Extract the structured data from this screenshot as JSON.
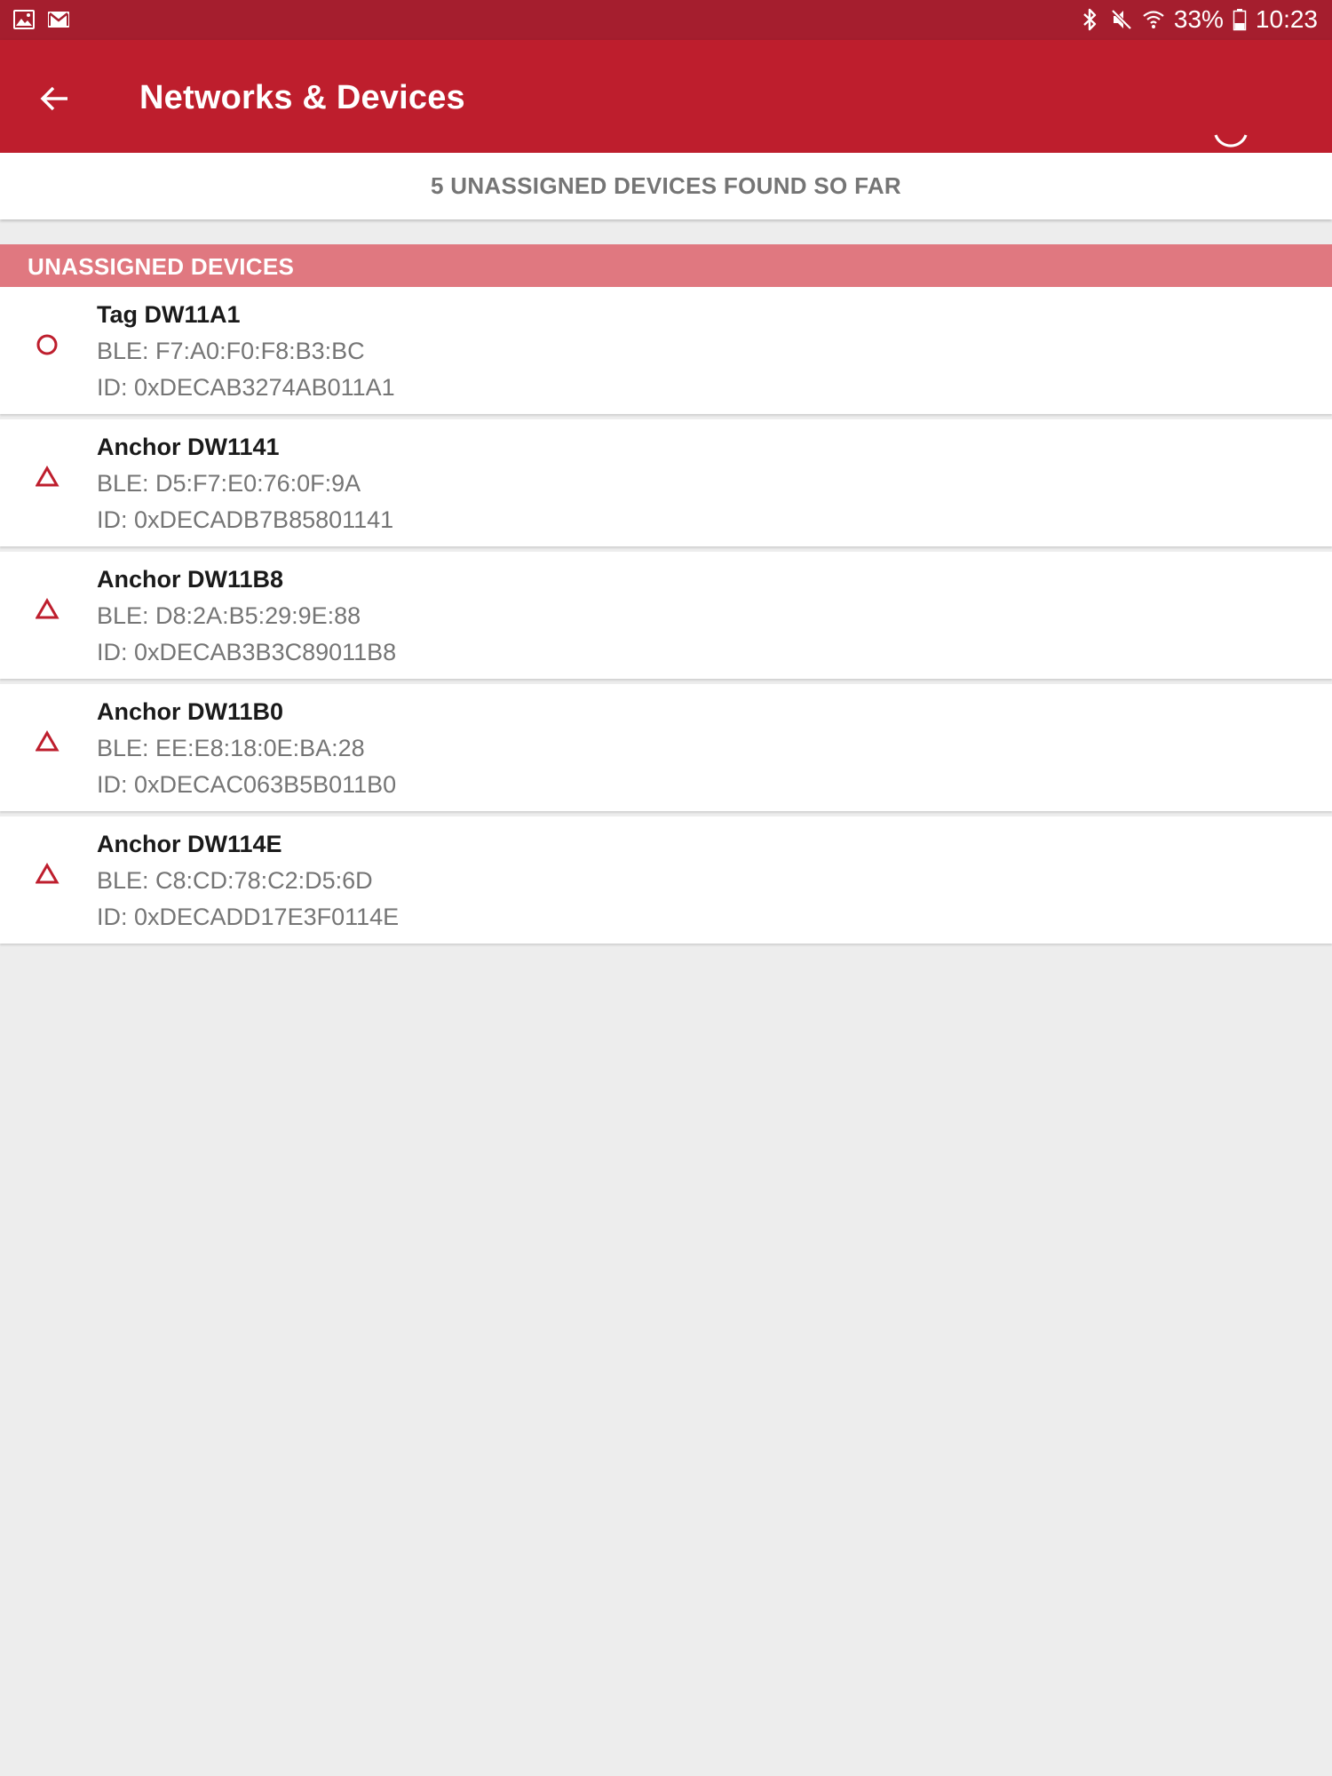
{
  "status_bar": {
    "left_icons": [
      "gallery-icon",
      "gmail-icon"
    ],
    "right_icons": [
      "bluetooth-icon",
      "mute-icon",
      "wifi-icon",
      "battery-icon"
    ],
    "battery": "33%",
    "time": "10:23"
  },
  "app_bar": {
    "title": "Networks & Devices",
    "back_icon": "arrow-left-icon",
    "progress_icon": "loading-spinner-icon",
    "color": "#be1e2d"
  },
  "found_banner": {
    "text": "5 UNASSIGNED DEVICES FOUND SO FAR"
  },
  "section": {
    "title": "UNASSIGNED DEVICES",
    "color": "#e07880"
  },
  "devices": [
    {
      "icon": "tag-circle-icon",
      "name": "Tag DW11A1",
      "ble": "BLE: F7:A0:F0:F8:B3:BC",
      "id": "ID: 0xDECAB3274AB011A1"
    },
    {
      "icon": "anchor-triangle-icon",
      "name": "Anchor DW1141",
      "ble": "BLE: D5:F7:E0:76:0F:9A",
      "id": "ID: 0xDECADB7B85801141"
    },
    {
      "icon": "anchor-triangle-icon",
      "name": "Anchor DW11B8",
      "ble": "BLE: D8:2A:B5:29:9E:88",
      "id": "ID: 0xDECAB3B3C89011B8"
    },
    {
      "icon": "anchor-triangle-icon",
      "name": "Anchor DW11B0",
      "ble": "BLE: EE:E8:18:0E:BA:28",
      "id": "ID: 0xDECAC063B5B011B0"
    },
    {
      "icon": "anchor-triangle-icon",
      "name": "Anchor DW114E",
      "ble": "BLE: C8:CD:78:C2:D5:6D",
      "id": "ID: 0xDECADD17E3F0114E"
    }
  ],
  "colors": {
    "status_bar": "#a51e2e",
    "icon_red": "#be1e2d",
    "background": "#ededed"
  }
}
